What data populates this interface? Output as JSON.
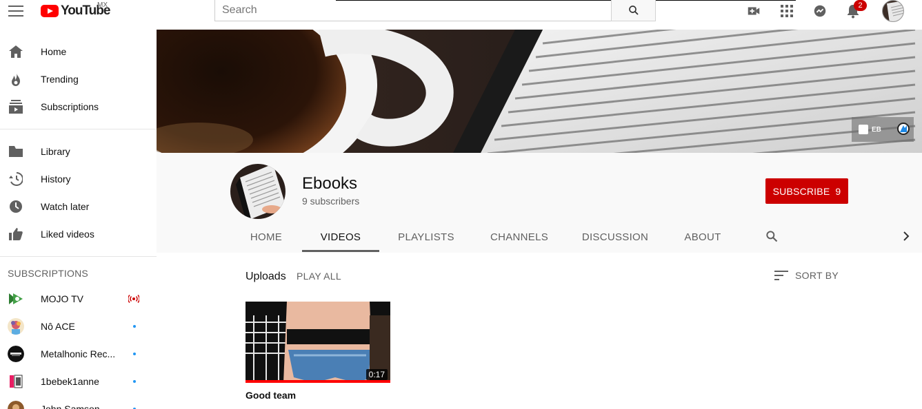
{
  "masthead": {
    "logo_text": "YouTube",
    "country": "MX",
    "search_placeholder": "Search",
    "notification_count": "2",
    "icons": [
      "menu-icon",
      "search-icon",
      "create-video-icon",
      "apps-icon",
      "messages-icon",
      "notifications-icon"
    ]
  },
  "sidebar": {
    "main": [
      {
        "label": "Home",
        "icon": "home-icon"
      },
      {
        "label": "Trending",
        "icon": "trending-icon"
      },
      {
        "label": "Subscriptions",
        "icon": "subscriptions-icon"
      }
    ],
    "library": [
      {
        "label": "Library",
        "icon": "library-icon"
      },
      {
        "label": "History",
        "icon": "history-icon"
      },
      {
        "label": "Watch later",
        "icon": "watch-later-icon"
      },
      {
        "label": "Liked videos",
        "icon": "liked-videos-icon"
      }
    ],
    "subscriptions_header": "SUBSCRIPTIONS",
    "subscriptions": [
      {
        "label": "MOJO TV",
        "status": "live"
      },
      {
        "label": "Nô ACE",
        "status": "new"
      },
      {
        "label": "Metalhonic Rec...",
        "status": "new"
      },
      {
        "label": "1bebek1anne",
        "status": "new"
      },
      {
        "label": "John Samson",
        "status": "new"
      }
    ]
  },
  "banner": {
    "links": [
      "EB"
    ]
  },
  "channel": {
    "name": "Ebooks",
    "subscribers": "9 subscribers",
    "subscribe_label": "SUBSCRIBE",
    "subscribe_count": "9",
    "tabs": [
      "HOME",
      "VIDEOS",
      "PLAYLISTS",
      "CHANNELS",
      "DISCUSSION",
      "ABOUT"
    ],
    "active_tab": "VIDEOS"
  },
  "content": {
    "section_title": "Uploads",
    "play_all": "PLAY ALL",
    "sort_by": "SORT BY",
    "videos": [
      {
        "title": "Good team",
        "duration": "0:17",
        "watched_fraction": 1.0
      }
    ]
  },
  "colors": {
    "brand_red": "#ff0000",
    "subscribe_red": "#cc0000",
    "live_red": "#cc0000",
    "new_dot_blue": "#2196f3"
  }
}
